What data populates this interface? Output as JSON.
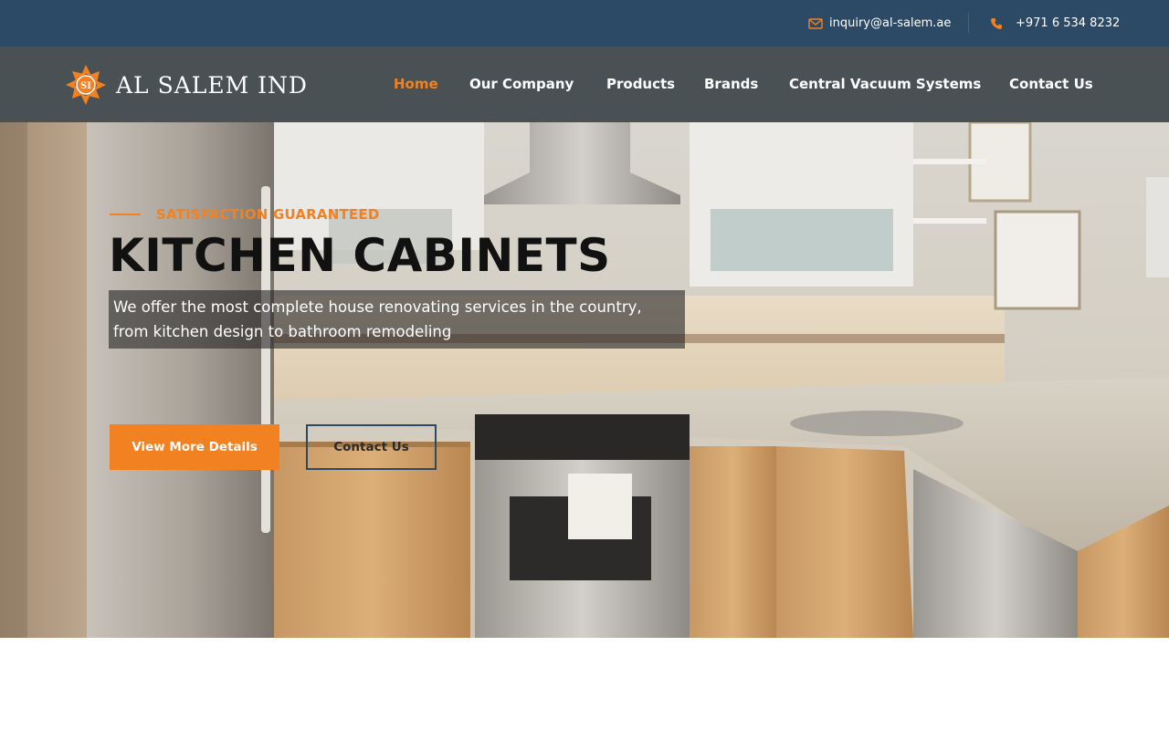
{
  "topbar": {
    "email": "inquiry@al-salem.ae",
    "phone": "+971 6 534 8232",
    "email_icon": "envelope-icon",
    "phone_icon": "phone-icon"
  },
  "brand": {
    "logo_mark": "SI",
    "logo_text": "AL SALEM IND"
  },
  "nav": {
    "items": [
      {
        "label": "Home",
        "active": true
      },
      {
        "label": "Our Company",
        "active": false
      },
      {
        "label": "Products",
        "active": false
      },
      {
        "label": "Brands",
        "active": false
      },
      {
        "label": "Central Vacuum Systems",
        "active": false
      },
      {
        "label": "Contact Us",
        "active": false
      }
    ]
  },
  "hero": {
    "eyebrow": "SATISFACTION GUARANTEED",
    "title": "KITCHEN CABINETS",
    "description_line1": "We offer the most complete house renovating services in the country,",
    "description_line2": "from kitchen design to bathroom remodeling",
    "primary_button": "View More Details",
    "secondary_button": "Contact Us"
  },
  "colors": {
    "accent": "#f28122",
    "topbar": "#2c4a66",
    "navbar": "#4a5154"
  }
}
